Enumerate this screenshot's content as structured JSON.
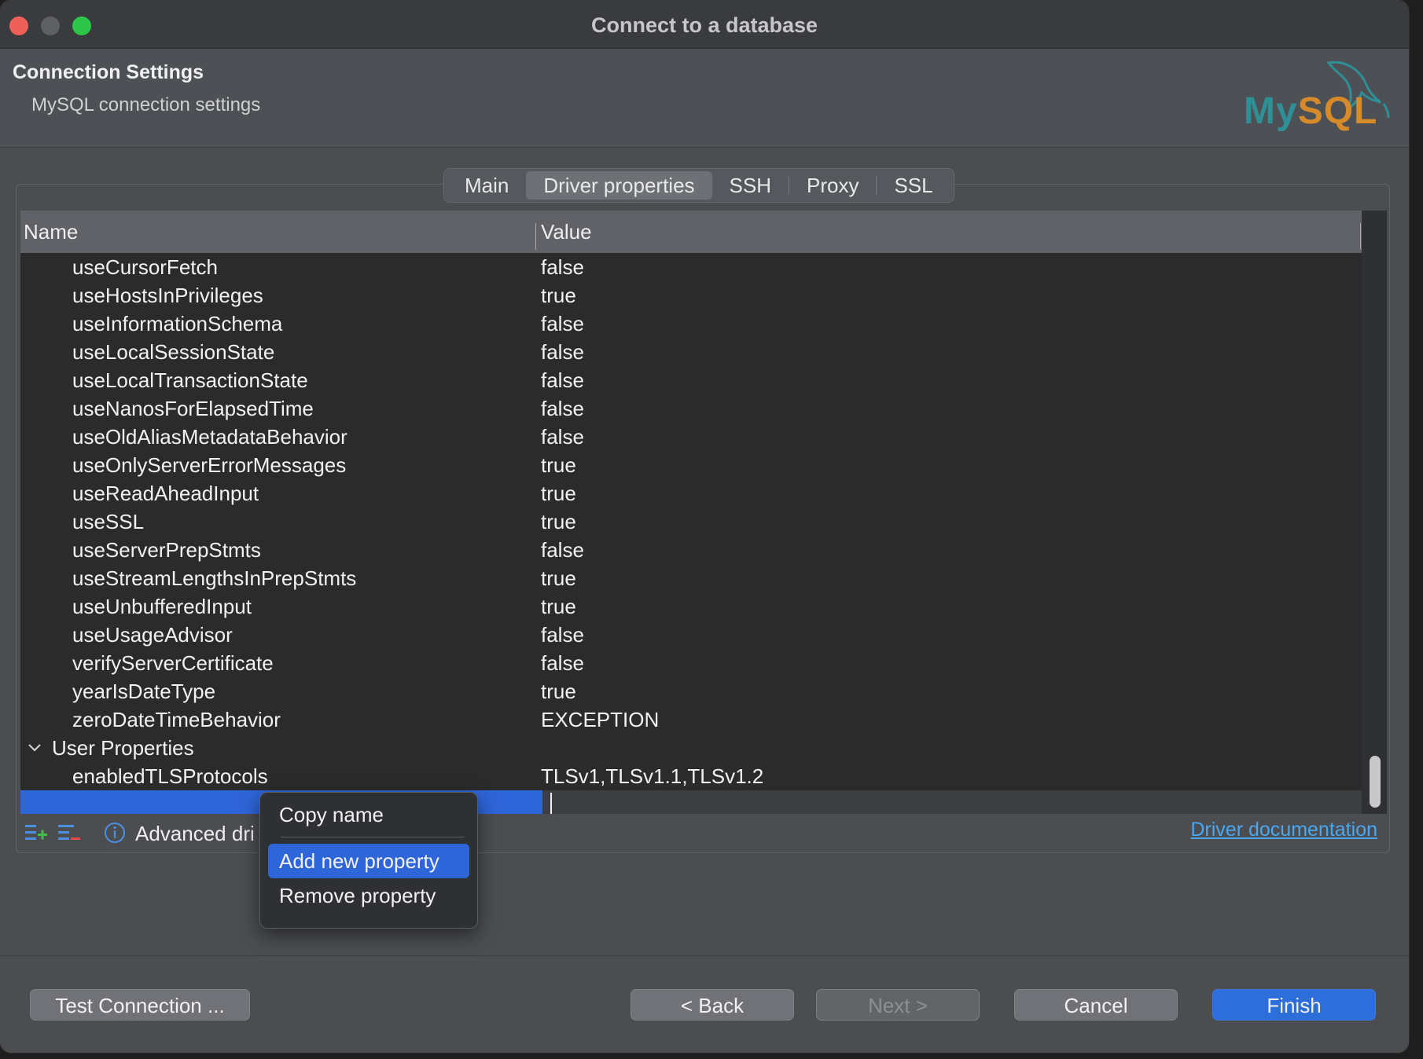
{
  "window": {
    "title": "Connect to a database"
  },
  "header": {
    "title": "Connection Settings",
    "subtitle": "MySQL connection settings",
    "logo_text_a": "My",
    "logo_text_b": "SQL"
  },
  "tabs": [
    {
      "label": "Main",
      "active": false
    },
    {
      "label": "Driver properties",
      "active": true
    },
    {
      "label": "SSH",
      "active": false
    },
    {
      "label": "Proxy",
      "active": false
    },
    {
      "label": "SSL",
      "active": false
    }
  ],
  "table": {
    "columns": [
      "Name",
      "Value"
    ],
    "rows": [
      {
        "name": "useCursorFetch",
        "value": "false"
      },
      {
        "name": "useHostsInPrivileges",
        "value": "true"
      },
      {
        "name": "useInformationSchema",
        "value": "false"
      },
      {
        "name": "useLocalSessionState",
        "value": "false"
      },
      {
        "name": "useLocalTransactionState",
        "value": "false"
      },
      {
        "name": "useNanosForElapsedTime",
        "value": "false"
      },
      {
        "name": "useOldAliasMetadataBehavior",
        "value": "false"
      },
      {
        "name": "useOnlyServerErrorMessages",
        "value": "true"
      },
      {
        "name": "useReadAheadInput",
        "value": "true"
      },
      {
        "name": "useSSL",
        "value": "true"
      },
      {
        "name": "useServerPrepStmts",
        "value": "false"
      },
      {
        "name": "useStreamLengthsInPrepStmts",
        "value": "true"
      },
      {
        "name": "useUnbufferedInput",
        "value": "true"
      },
      {
        "name": "useUsageAdvisor",
        "value": "false"
      },
      {
        "name": "verifyServerCertificate",
        "value": "false"
      },
      {
        "name": "yearIsDateType",
        "value": "true"
      },
      {
        "name": "zeroDateTimeBehavior",
        "value": "EXCEPTION"
      }
    ],
    "group": {
      "label": "User Properties",
      "rows": [
        {
          "name": "enabledTLSProtocols",
          "value": "TLSv1,TLSv1.1,TLSv1.2"
        }
      ]
    }
  },
  "footer": {
    "advanced_text": "Advanced dri",
    "driver_documentation": "Driver documentation"
  },
  "context_menu": {
    "items": [
      {
        "label": "Copy name"
      },
      {
        "label": "Add new property"
      },
      {
        "label": "Remove property"
      }
    ]
  },
  "buttons": {
    "test_connection": "Test Connection ...",
    "back": "< Back",
    "next": "Next >",
    "cancel": "Cancel",
    "finish": "Finish"
  },
  "colors": {
    "accent": "#2e65d8",
    "link": "#4aa7f0",
    "logo_teal": "#2e8f96",
    "logo_orange": "#d68a2a"
  }
}
